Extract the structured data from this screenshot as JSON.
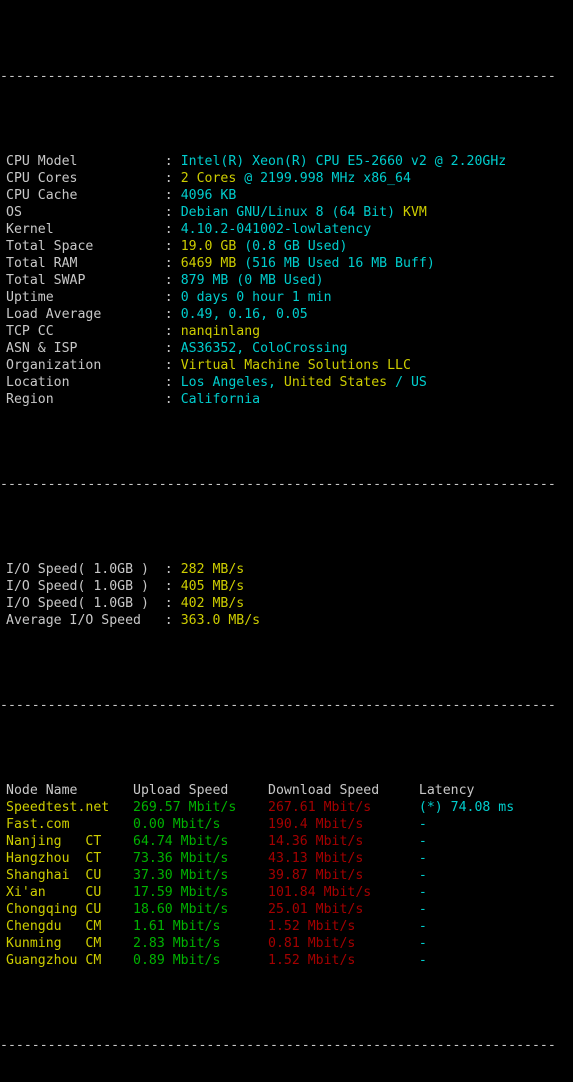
{
  "terminal": {
    "divider": "----------------------------------------------------------------------",
    "colors": {
      "background": "#000000",
      "label": "#c8c8c8",
      "cyan": "#00cdcd",
      "yellow": "#cdcd00",
      "green": "#00b200",
      "red": "#a40000"
    }
  },
  "system_info": {
    "rows": [
      {
        "label": "CPU Model",
        "value": "Intel(R) Xeon(R) CPU E5-2660 v2 @ 2.20GHz",
        "color": "cyan"
      },
      {
        "label": "CPU Cores",
        "value": "2 Cores @ 2199.998 MHz x86_64",
        "color": "mixed_cores"
      },
      {
        "label": "CPU Cache",
        "value": "4096 KB",
        "color": "cyan"
      },
      {
        "label": "OS",
        "value": "Debian GNU/Linux 8 (64 Bit) KVM",
        "color": "mixed_os"
      },
      {
        "label": "Kernel",
        "value": "4.10.2-041002-lowlatency",
        "color": "cyan"
      },
      {
        "label": "Total Space",
        "value": "19.0 GB (0.8 GB Used)",
        "color": "mixed_space"
      },
      {
        "label": "Total RAM",
        "value": "6469 MB (516 MB Used 16 MB Buff)",
        "color": "mixed_ram"
      },
      {
        "label": "Total SWAP",
        "value": "879 MB (0 MB Used)",
        "color": "cyan"
      },
      {
        "label": "Uptime",
        "value": "0 days 0 hour 1 min",
        "color": "cyan"
      },
      {
        "label": "Load Average",
        "value": "0.49, 0.16, 0.05",
        "color": "cyan"
      },
      {
        "label": "TCP CC",
        "value": "nanqinlang",
        "color": "yellow"
      },
      {
        "label": "ASN & ISP",
        "value": "AS36352, ColoCrossing",
        "color": "cyan"
      },
      {
        "label": "Organization",
        "value": "Virtual Machine Solutions LLC",
        "color": "yellow"
      },
      {
        "label": "Location",
        "value": "Los Angeles, United States / US",
        "color": "mixed_loc"
      },
      {
        "label": "Region",
        "value": "California",
        "color": "cyan"
      }
    ],
    "parts": {
      "cpu_cores_a": "2 Cores",
      "cpu_cores_b": " @ 2199.998 MHz x86_64",
      "os_a": "Debian GNU/Linux 8 (64 Bit) ",
      "os_b": "KVM",
      "space_a": "19.0 GB",
      "space_b": " (0.8 GB Used)",
      "ram_a": "6469 MB",
      "ram_b": " (516 MB Used 16 MB Buff)",
      "loc_a": "Los Angeles, ",
      "loc_b": "United States",
      "loc_c": " / US"
    }
  },
  "io_tests": {
    "rows": [
      {
        "label": "I/O Speed( 1.0GB )",
        "value": "282 MB/s"
      },
      {
        "label": "I/O Speed( 1.0GB )",
        "value": "405 MB/s"
      },
      {
        "label": "I/O Speed( 1.0GB )",
        "value": "402 MB/s"
      },
      {
        "label": "Average I/O Speed",
        "value": "363.0 MB/s"
      }
    ]
  },
  "speedtest": {
    "headers": {
      "node_name": "Node Name",
      "upload_speed": "Upload Speed",
      "download_speed": "Download Speed",
      "latency": "Latency"
    },
    "rows": [
      {
        "node": "Speedtest.net",
        "isp": "",
        "upload": "269.57 Mbit/s",
        "download": "267.61 Mbit/s",
        "latency": "(*) 74.08 ms"
      },
      {
        "node": "Fast.com",
        "isp": "",
        "upload": "0.00 Mbit/s",
        "download": "190.4 Mbit/s",
        "latency": "-"
      },
      {
        "node": "Nanjing",
        "isp": "CT",
        "upload": "64.74 Mbit/s",
        "download": "14.36 Mbit/s",
        "latency": "-"
      },
      {
        "node": "Hangzhou",
        "isp": "CT",
        "upload": "73.36 Mbit/s",
        "download": "43.13 Mbit/s",
        "latency": "-"
      },
      {
        "node": "Shanghai",
        "isp": "CU",
        "upload": "37.30 Mbit/s",
        "download": "39.87 Mbit/s",
        "latency": "-"
      },
      {
        "node": "Xi'an",
        "isp": "CU",
        "upload": "17.59 Mbit/s",
        "download": "101.84 Mbit/s",
        "latency": "-"
      },
      {
        "node": "Chongqing",
        "isp": "CU",
        "upload": "18.60 Mbit/s",
        "download": "25.01 Mbit/s",
        "latency": "-"
      },
      {
        "node": "Chengdu",
        "isp": "CM",
        "upload": "1.61 Mbit/s",
        "download": "1.52 Mbit/s",
        "latency": "-"
      },
      {
        "node": "Kunming",
        "isp": "CM",
        "upload": "2.83 Mbit/s",
        "download": "0.81 Mbit/s",
        "latency": "-"
      },
      {
        "node": "Guangzhou",
        "isp": "CM",
        "upload": "0.89 Mbit/s",
        "download": "1.52 Mbit/s",
        "latency": "-"
      }
    ]
  }
}
